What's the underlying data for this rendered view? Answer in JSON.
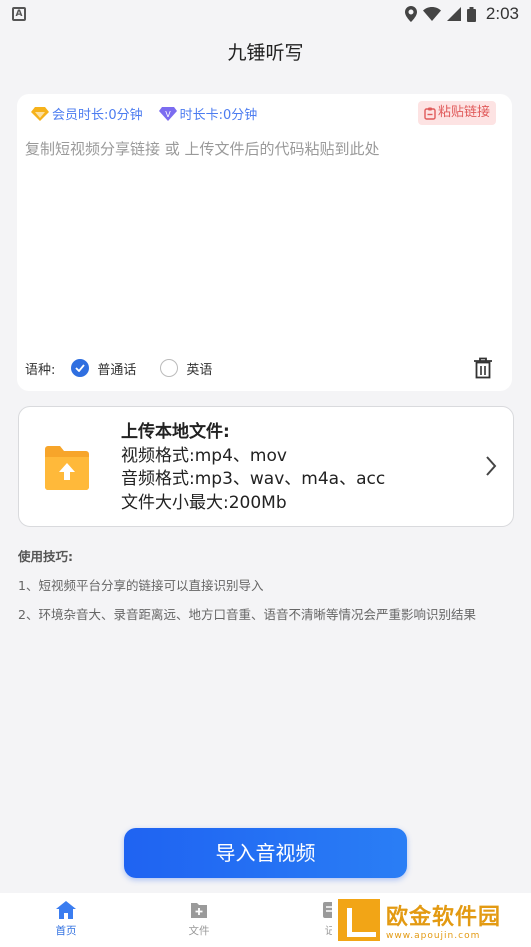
{
  "status_bar": {
    "time": "2:03"
  },
  "header": {
    "title": "九锤听写"
  },
  "input_card": {
    "member_duration": "会员时长:0分钟",
    "card_duration": "时长卡:0分钟",
    "paste_button": "粘贴链接",
    "placeholder": "复制短视频分享链接 或 上传文件后的代码粘贴到此处",
    "language_label": "语种:",
    "language_options": [
      {
        "label": "普通话",
        "selected": true
      },
      {
        "label": "英语",
        "selected": false
      }
    ]
  },
  "upload_card": {
    "title": "上传本地文件:",
    "video_format": "视频格式:mp4、mov",
    "audio_format": "音频格式:mp3、wav、m4a、acc",
    "max_size": "文件大小最大:200Mb"
  },
  "tips": {
    "title": "使用技巧:",
    "items": [
      "1、短视频平台分享的链接可以直接识别导入",
      "2、环境杂音大、录音距离远、地方口音重、语音不清晰等情况会严重影响识别结果"
    ]
  },
  "import_button": "导入音视频",
  "tabbar": {
    "items": [
      {
        "label": "首页",
        "icon": "home-icon",
        "active": true
      },
      {
        "label": "文件",
        "icon": "file-add-icon",
        "active": false
      },
      {
        "label": "记",
        "icon": "record-icon",
        "active": false
      }
    ]
  },
  "watermark": {
    "title": "欧金软件园",
    "url": "www.apoujin.com"
  },
  "colors": {
    "accent": "#2f6fe0",
    "paste": "#e05a5a",
    "folder": "#f5a623"
  }
}
